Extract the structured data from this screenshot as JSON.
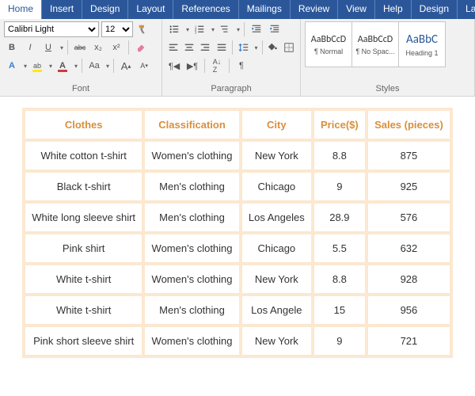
{
  "tabs": [
    "Home",
    "Insert",
    "Design",
    "Layout",
    "References",
    "Mailings",
    "Review",
    "View",
    "Help",
    "Design",
    "Layout"
  ],
  "activeTab": 0,
  "font": {
    "name": "Calibri Light",
    "size": "12",
    "bold": "B",
    "italic": "I",
    "underline": "U",
    "strike": "abc",
    "sub": "x₂",
    "sup": "x²",
    "grow": "A",
    "shrink": "A",
    "clear": "Aa"
  },
  "groups": {
    "font": "Font",
    "paragraph": "Paragraph",
    "styles": "Styles"
  },
  "styles": [
    {
      "preview": "AaBbCcD",
      "name": "¶ Normal",
      "size": "12px",
      "color": "#333"
    },
    {
      "preview": "AaBbCcD",
      "name": "¶ No Spac...",
      "size": "12px",
      "color": "#333"
    },
    {
      "preview": "AaBbC",
      "name": "Heading 1",
      "size": "15px",
      "color": "#2b579a"
    }
  ],
  "table": {
    "headers": [
      "Clothes",
      "Classification",
      "City",
      "Price($)",
      "Sales (pieces)"
    ],
    "rows": [
      [
        "White cotton t-shirt",
        "Women's clothing",
        "New York",
        "8.8",
        "875"
      ],
      [
        "Black t-shirt",
        "Men's clothing",
        "Chicago",
        "9",
        "925"
      ],
      [
        "White long sleeve shirt",
        "Men's clothing",
        "Los Angeles",
        "28.9",
        "576"
      ],
      [
        "Pink shirt",
        "Women's clothing",
        "Chicago",
        "5.5",
        "632"
      ],
      [
        "White t-shirt",
        "Women's clothing",
        "New York",
        "8.8",
        "928"
      ],
      [
        "White t-shirt",
        "Men's clothing",
        "Los Angele",
        "15",
        "956"
      ],
      [
        "Pink short sleeve shirt",
        "Women's clothing",
        "New York",
        "9",
        "721"
      ]
    ]
  }
}
